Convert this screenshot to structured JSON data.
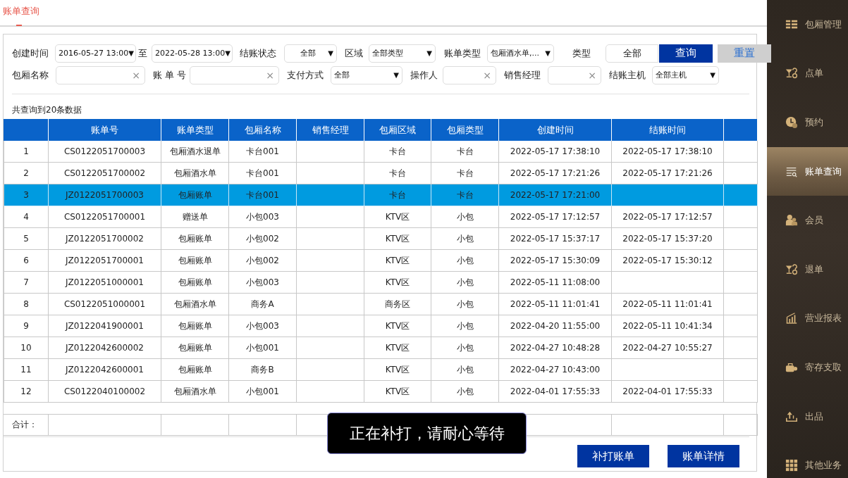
{
  "page_title": "账单查询",
  "filters": [
    [
      {
        "kind": "label",
        "text": "创建时间"
      },
      {
        "kind": "select",
        "value": "2016-05-27 13:00",
        "caret": "▼"
      },
      {
        "kind": "label",
        "text": "至"
      },
      {
        "kind": "select",
        "value": "2022-05-28 13:00",
        "caret": "▼"
      },
      {
        "kind": "label",
        "text": "结账状态"
      },
      {
        "kind": "select",
        "value": "全部",
        "caret": "▼",
        "centered": true
      },
      {
        "kind": "label",
        "text": "区域"
      },
      {
        "kind": "select",
        "value": "全部类型",
        "caret": "▼"
      },
      {
        "kind": "label",
        "text": "账单类型"
      },
      {
        "kind": "select",
        "value": "包厢酒水单,...",
        "caret": "▼"
      },
      {
        "kind": "label",
        "text": "类型"
      },
      {
        "kind": "display",
        "value": "全部"
      },
      {
        "kind": "button",
        "text": "查询",
        "primary": true
      },
      {
        "kind": "button",
        "text": "重置",
        "primary": false
      }
    ],
    [
      {
        "kind": "label",
        "text": "包厢名称"
      },
      {
        "kind": "field",
        "clear": "×"
      },
      {
        "kind": "label",
        "text": "账 单 号"
      },
      {
        "kind": "field",
        "clear": "×"
      },
      {
        "kind": "label",
        "text": "支付方式"
      },
      {
        "kind": "select",
        "value": "全部",
        "caret": "▼"
      },
      {
        "kind": "label",
        "text": "操作人"
      },
      {
        "kind": "field",
        "clear": "×"
      },
      {
        "kind": "label",
        "text": "销售经理"
      },
      {
        "kind": "field",
        "clear": "×"
      },
      {
        "kind": "label",
        "text": "结账主机"
      },
      {
        "kind": "select",
        "value": "全部主机",
        "caret": "▼"
      }
    ]
  ],
  "result_count": "共查询到20条数据",
  "table": {
    "columns": [
      "",
      "账单号",
      "账单类型",
      "包厢名称",
      "销售经理",
      "包厢区域",
      "包厢类型",
      "创建时间",
      "结账时间"
    ],
    "rows": [
      {
        "cells": [
          "1",
          "CS0122051700003",
          "包厢酒水退单",
          "卡台001",
          null,
          "卡台",
          "卡台",
          "2022-05-17 17:38:10",
          "2022-05-17 17:38:10"
        ],
        "selected": false
      },
      {
        "cells": [
          "2",
          "CS0122051700002",
          "包厢酒水单",
          "卡台001",
          null,
          "卡台",
          "卡台",
          "2022-05-17 17:21:26",
          "2022-05-17 17:21:26"
        ],
        "selected": false
      },
      {
        "cells": [
          "3",
          "JZ0122051700003",
          "包厢账单",
          "卡台001",
          null,
          "卡台",
          "卡台",
          "2022-05-17 17:21:00",
          null
        ],
        "selected": true
      },
      {
        "cells": [
          "4",
          "CS0122051700001",
          "赠送单",
          "小包003",
          null,
          "KTV区",
          "小包",
          "2022-05-17 17:12:57",
          "2022-05-17 17:12:57"
        ],
        "selected": false
      },
      {
        "cells": [
          "5",
          "JZ0122051700002",
          "包厢账单",
          "小包002",
          null,
          "KTV区",
          "小包",
          "2022-05-17 15:37:17",
          "2022-05-17 15:37:20"
        ],
        "selected": false
      },
      {
        "cells": [
          "6",
          "JZ0122051700001",
          "包厢账单",
          "小包002",
          null,
          "KTV区",
          "小包",
          "2022-05-17 15:30:09",
          "2022-05-17 15:30:12"
        ],
        "selected": false
      },
      {
        "cells": [
          "7",
          "JZ0122051000001",
          "包厢账单",
          "小包003",
          null,
          "KTV区",
          "小包",
          "2022-05-11 11:08:00",
          null
        ],
        "selected": false
      },
      {
        "cells": [
          "8",
          "CS0122051000001",
          "包厢酒水单",
          "商务A",
          null,
          "商务区",
          "小包",
          "2022-05-11 11:01:41",
          "2022-05-11 11:01:41"
        ],
        "selected": false
      },
      {
        "cells": [
          "9",
          "JZ0122041900001",
          "包厢账单",
          "小包003",
          null,
          "KTV区",
          "小包",
          "2022-04-20 11:55:00",
          "2022-05-11 10:41:34"
        ],
        "selected": false
      },
      {
        "cells": [
          "10",
          "JZ0122042600002",
          "包厢账单",
          "小包001",
          null,
          "KTV区",
          "小包",
          "2022-04-27 10:48:28",
          "2022-04-27 10:55:27"
        ],
        "selected": false
      },
      {
        "cells": [
          "11",
          "JZ0122042600001",
          "包厢账单",
          "商务B",
          null,
          "KTV区",
          "小包",
          "2022-04-27 10:43:00",
          null
        ],
        "selected": false
      },
      {
        "cells": [
          "12",
          "CS0122040100002",
          "包厢酒水单",
          "小包001",
          null,
          "KTV区",
          "小包",
          "2022-04-01 17:55:33",
          "2022-04-01 17:55:33"
        ],
        "selected": false
      }
    ],
    "total_label": "合计："
  },
  "toast": "正在补打，请耐心等待",
  "actions": [
    "补打账单",
    "账单详情"
  ],
  "sidebar": [
    {
      "label": "包厢管理",
      "selected": false
    },
    {
      "label": "点单",
      "selected": false
    },
    {
      "label": "预约",
      "selected": false
    },
    {
      "label": "账单查询",
      "selected": true
    },
    {
      "label": "会员",
      "selected": false
    },
    {
      "label": "退单",
      "selected": false
    },
    {
      "label": "营业报表",
      "selected": false
    },
    {
      "label": "寄存支取",
      "selected": false
    },
    {
      "label": "出品",
      "selected": false
    },
    {
      "label": "其他业务",
      "selected": false
    }
  ]
}
